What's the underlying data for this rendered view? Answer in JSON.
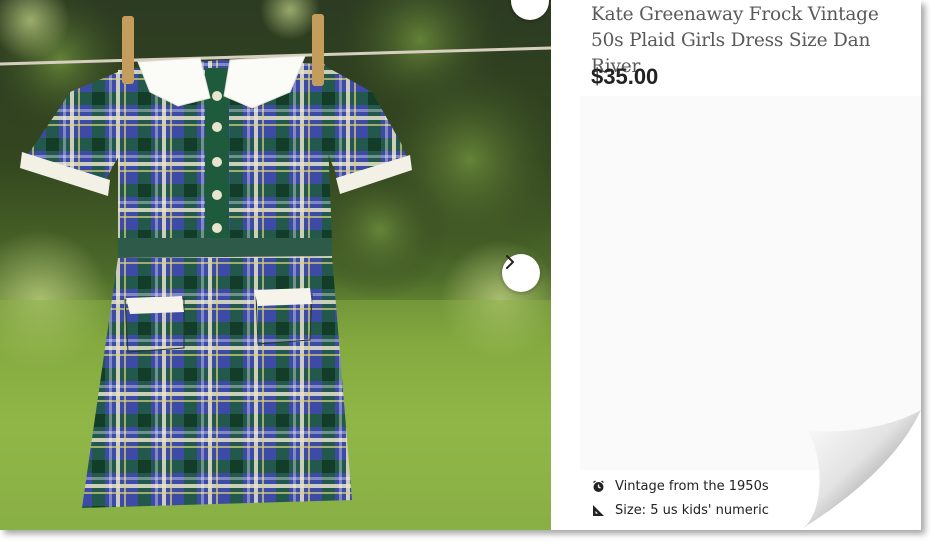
{
  "listing": {
    "title": "Kate Greenaway Frock Vintage 50s Plaid Girls Dress Size Dan River",
    "price": "$35.00"
  },
  "gallery": {
    "next_icon": "chevron-right-icon",
    "favorite_icon": "heart-icon"
  },
  "details": [
    {
      "icon": "clock-icon",
      "text": "Vintage from the 1950s"
    },
    {
      "icon": "ruler-icon",
      "text": "Size: 5 us kids' numeric"
    }
  ],
  "colors": {
    "price": "#222222",
    "title": "#595959",
    "plaid_blue": "#3f45a8",
    "plaid_green": "#1f5a3c"
  }
}
